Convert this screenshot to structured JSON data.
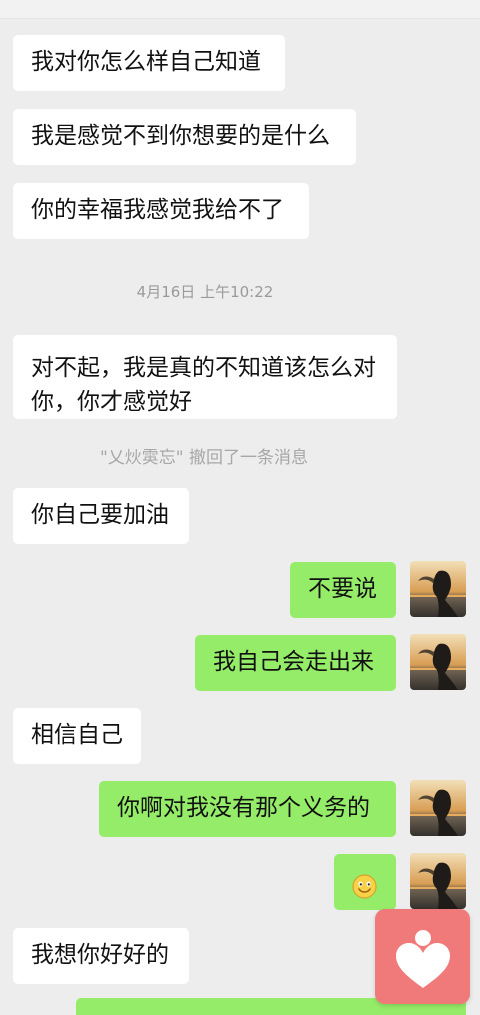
{
  "chat": {
    "messages": [
      {
        "side": "in",
        "text": "我对你怎么样自己知道"
      },
      {
        "side": "in",
        "text": "我是感觉不到你想要的是什么"
      },
      {
        "side": "in",
        "text": "你的幸福我感觉我给不了"
      },
      {
        "timestamp": "4月16日 上午10:22"
      },
      {
        "side": "in",
        "text": "对不起，我是真的不知道该怎么对你，你才感觉好"
      },
      {
        "recalled": "\"乂炏雵忘\" 撤回了一条消息"
      },
      {
        "side": "in",
        "text": "你自己要加油"
      },
      {
        "side": "out",
        "text": "不要说"
      },
      {
        "side": "out",
        "text": "我自己会走出来"
      },
      {
        "side": "in",
        "text": "相信自己"
      },
      {
        "side": "out",
        "text": "你啊对我没有那个义务的"
      },
      {
        "side": "out",
        "emoji": "smile-emoji"
      },
      {
        "side": "in",
        "text": "我想你好好的"
      }
    ]
  },
  "colors": {
    "background": "#ededed",
    "incoming_bubble": "#ffffff",
    "outgoing_bubble": "#95ec69",
    "floating_button": "#f07a79",
    "timestamp_text": "#9a9a9a"
  },
  "icons": {
    "avatar": "sunset-silhouette-avatar",
    "floating_button": "heart-person-icon",
    "emoji": "smile-emoji"
  }
}
